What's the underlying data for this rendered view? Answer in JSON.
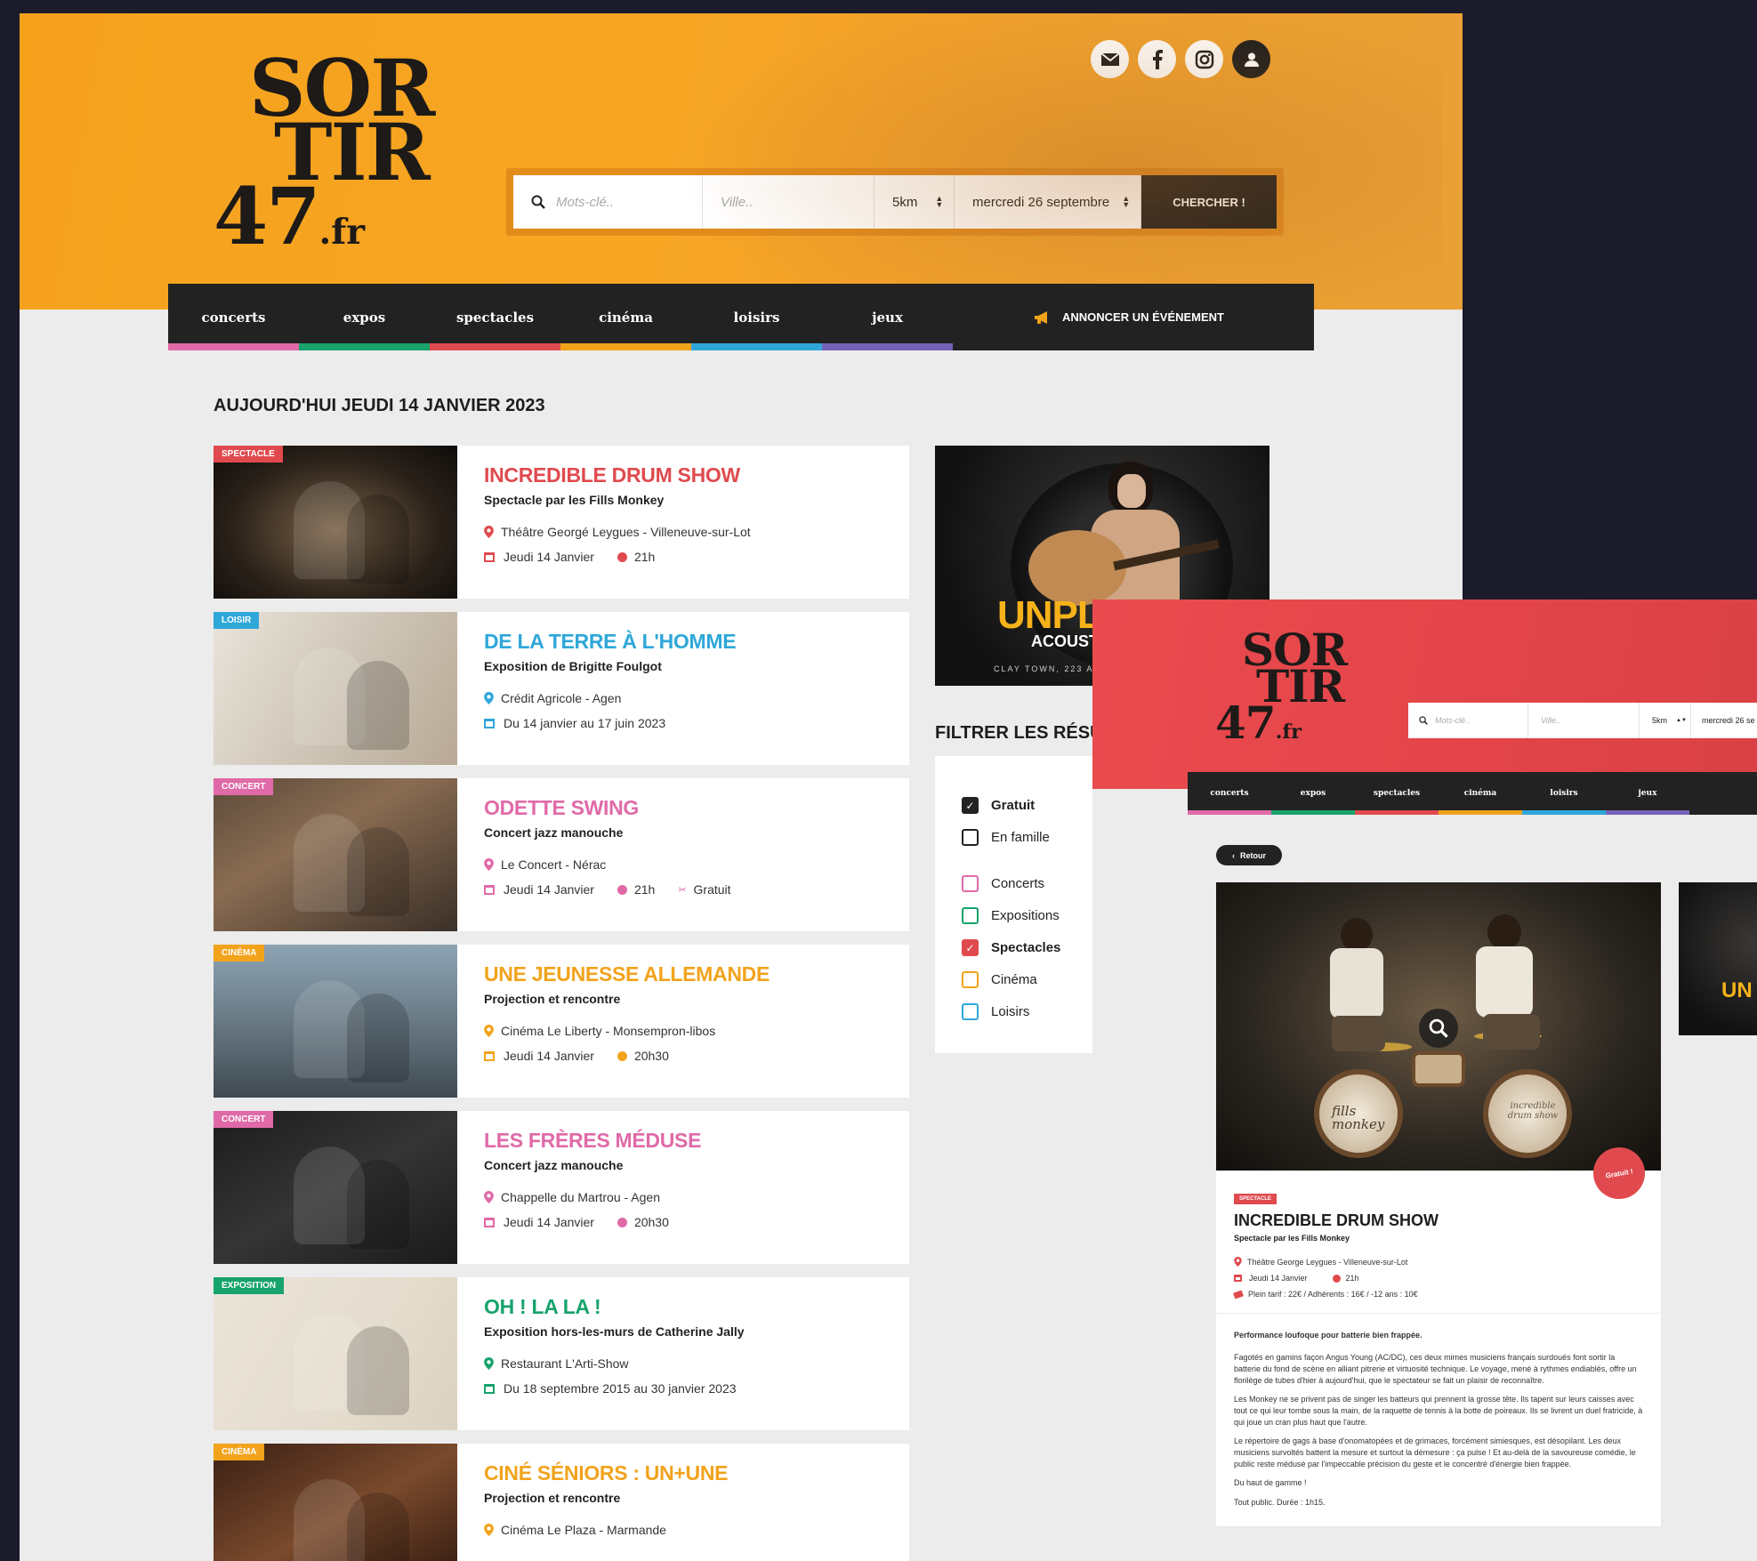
{
  "main": {
    "logo": {
      "line1": "SOR",
      "line2": "TIR",
      "line3": "47",
      "suffix": ".fr"
    },
    "social": {
      "mail": "mail-icon",
      "facebook": "facebook-icon",
      "instagram": "instagram-icon",
      "account": "user-icon"
    },
    "search": {
      "keyword_placeholder": "Mots-clé..",
      "city_placeholder": "Ville..",
      "radius": "5km",
      "date": "mercredi 26 septembre",
      "button": "CHERCHER !"
    },
    "nav": [
      {
        "label": "concerts",
        "color": "#e06aa8"
      },
      {
        "label": "expos",
        "color": "#17a36b"
      },
      {
        "label": "spectacles",
        "color": "#e04a4e"
      },
      {
        "label": "cinéma",
        "color": "#f2a31c"
      },
      {
        "label": "loisirs",
        "color": "#2fa7d9"
      },
      {
        "label": "jeux",
        "color": "#7562b8"
      }
    ],
    "announce": "ANNONCER UN ÉVÉNEMENT",
    "date_title": "AUJOURD'HUI JEUDI 14 JANVIER 2023",
    "events": [
      {
        "tag": "SPECTACLE",
        "color": "#e04a4e",
        "title": "INCREDIBLE DRUM SHOW",
        "subtitle": "Spectacle par les Fills Monkey",
        "place": "Théâtre Georgé Leygues - Villeneuve-sur-Lot",
        "date": "Jeudi 14 Janvier",
        "time": "21h",
        "extra": ""
      },
      {
        "tag": "LOISIR",
        "color": "#2fa7d9",
        "title": "DE LA TERRE À L'HOMME",
        "subtitle": "Exposition de Brigitte Foulgot",
        "place": "Crédit Agricole - Agen",
        "date": "Du 14 janvier au 17 juin 2023",
        "time": "",
        "extra": ""
      },
      {
        "tag": "CONCERT",
        "color": "#e06aa8",
        "title": "ODETTE SWING",
        "subtitle": "Concert jazz manouche",
        "place": "Le Concert - Nérac",
        "date": "Jeudi 14 Janvier",
        "time": "21h",
        "extra": "Gratuit"
      },
      {
        "tag": "CINÉMA",
        "color": "#f2a31c",
        "title": "UNE JEUNESSE ALLEMANDE",
        "subtitle": "Projection et rencontre",
        "place": "Cinéma Le Liberty - Monsempron-libos",
        "date": "Jeudi 14 Janvier",
        "time": "20h30",
        "extra": ""
      },
      {
        "tag": "CONCERT",
        "color": "#e06aa8",
        "title": "LES FRÈRES MÉDUSE",
        "subtitle": "Concert jazz manouche",
        "place": "Chappelle du Martrou - Agen",
        "date": "Jeudi 14 Janvier",
        "time": "20h30",
        "extra": ""
      },
      {
        "tag": "EXPOSITION",
        "color": "#17a36b",
        "title": "OH ! LA LA !",
        "subtitle": "Exposition hors-les-murs de Catherine Jally",
        "place": "Restaurant L'Arti-Show",
        "date": "Du 18 septembre 2015 au 30 janvier 2023",
        "time": "",
        "extra": ""
      },
      {
        "tag": "CINÉMA",
        "color": "#f2a31c",
        "title": "CINÉ SÉNIORS : UN+UNE",
        "subtitle": "Projection et rencontre",
        "place": "Cinéma Le Plaza - Marmande",
        "date": "",
        "time": "",
        "extra": ""
      }
    ],
    "ad": {
      "title": "UNPL",
      "subtitle": "ACOUST",
      "footer": "CLAY TOWN, 223 AV"
    },
    "filter": {
      "title": "FILTRER LES RÉSUL",
      "options": [
        {
          "label": "Gratuit",
          "checked": true,
          "color": "#222"
        },
        {
          "label": "En famille",
          "checked": false,
          "color": "#222"
        },
        {
          "label": "Concerts",
          "checked": false,
          "color": "#e06aa8"
        },
        {
          "label": "Expositions",
          "checked": false,
          "color": "#17a36b"
        },
        {
          "label": "Spectacles",
          "checked": true,
          "color": "#e04a4e"
        },
        {
          "label": "Cinéma",
          "checked": false,
          "color": "#f2a31c"
        },
        {
          "label": "Loisirs",
          "checked": false,
          "color": "#2fa7d9"
        }
      ]
    }
  },
  "detail": {
    "search": {
      "keyword_placeholder": "Mots-clé..",
      "city_placeholder": "Ville..",
      "radius": "5km",
      "date": "mercredi 26 se"
    },
    "nav": [
      "concerts",
      "expos",
      "spectacles",
      "cinéma",
      "loisirs",
      "jeux"
    ],
    "back": "Retour",
    "badge": "Gratuit !",
    "tag": "SPECTACLE",
    "title": "INCREDIBLE DRUM SHOW",
    "subtitle": "Spectacle par les Fills Monkey",
    "place": "Théâtre George Leygues - Villeneuve-sur-Lot",
    "date": "Jeudi 14 Janvier",
    "time": "21h",
    "price": "Plein tarif : 22€ / Adhérents : 16€ / -12 ans : 10€",
    "lead": "Performance loufoque pour batterie bien frappée.",
    "p1": "Fagotés en gamins façon Angus Young (AC/DC), ces deux mimes musiciens français surdoués font sortir la batterie du fond de scène en alliant pitrerie et virtuosité technique. Le voyage, mené à rythmes endiablés, offre un florilège de tubes d'hier à aujourd'hui, que le spectateur se fait un plaisir de reconnaître.",
    "p2": "Les Monkey ne se privent pas de singer les batteurs qui prennent la grosse tête. Ils tapent sur leurs caisses avec tout ce qui leur tombe sous la main, de la raquette de tennis à la botte de poireaux. Ils se livrent un duel fratricide, à qui joue un cran plus haut que l'autre.",
    "p3": "Le répertoire de gags à base d'onomatopées et de grimaces, forcément simiesques, est désopilant. Les deux musiciens survoltés battent la mesure et surtout la démesure : ça pulse ! Et au-delà de la savoureuse comédie, le public reste médusé par l'impeccable précision du geste et le concentré d'énergie bien frappée.",
    "p4": "Du haut de gamme !",
    "p5": "Tout public. Durée : 1h15.",
    "drum_left": "fills monkey",
    "drum_right": "incredible drum show",
    "side_ad": "UN"
  }
}
